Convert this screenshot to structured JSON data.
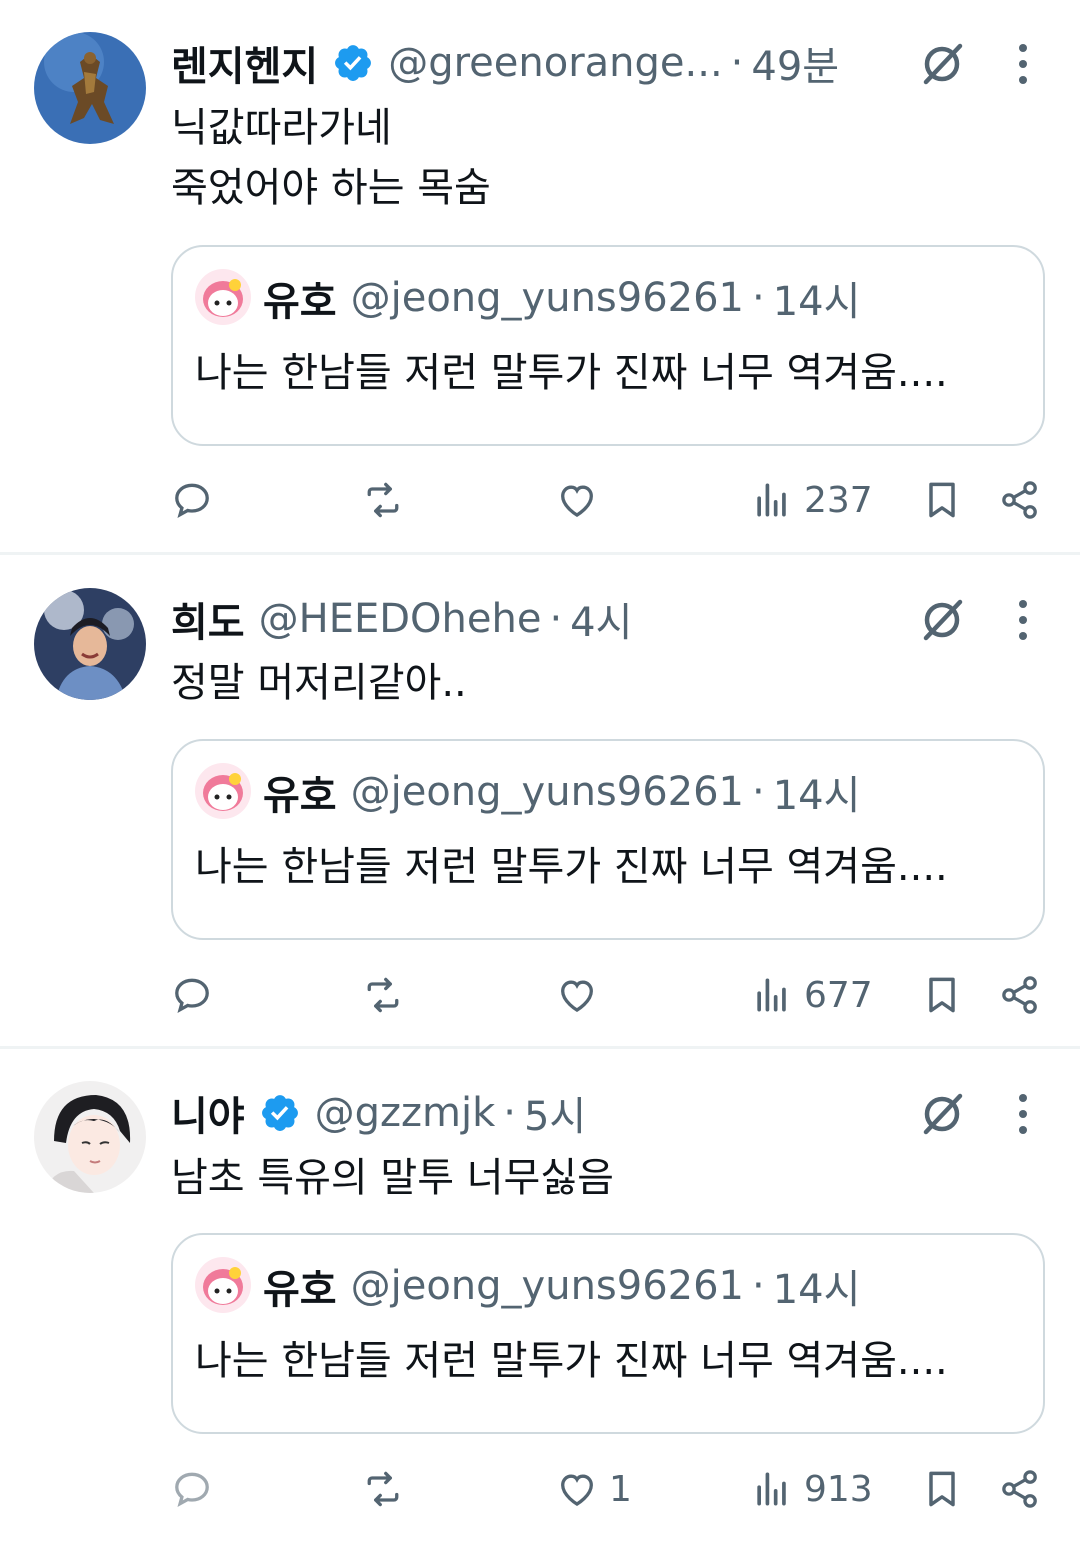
{
  "tweets": [
    {
      "name": "렌지헨지",
      "verified": true,
      "handle": "@greenorange...",
      "time": "49분",
      "lines": [
        "닉값따라가네",
        "죽었어야 하는 목숨"
      ],
      "quote": {
        "name": "유호",
        "handle": "@jeong_yuns96261",
        "time": "14시",
        "text": "나는 한남들 저런 말투가 진짜 너무 역겨움...."
      },
      "likes": "",
      "views": "237"
    },
    {
      "name": "희도",
      "verified": false,
      "handle": "@HEEDOhehe",
      "time": "4시",
      "lines": [
        "정말 머저리같아.."
      ],
      "quote": {
        "name": "유호",
        "handle": "@jeong_yuns96261",
        "time": "14시",
        "text": "나는 한남들 저런 말투가 진짜 너무 역겨움...."
      },
      "likes": "",
      "views": "677"
    },
    {
      "name": "니야",
      "verified": true,
      "handle": "@gzzmjk",
      "time": "5시",
      "lines": [
        "남초 특유의 말투 너무싫음"
      ],
      "quote": {
        "name": "유호",
        "handle": "@jeong_yuns96261",
        "time": "14시",
        "text": "나는 한남들 저런 말투가 진짜 너무 역겨움...."
      },
      "likes": "1",
      "views": "913"
    }
  ],
  "colors": {
    "text": "#0f1419",
    "secondary": "#536471",
    "verified": "#1d9bf0",
    "border": "#cfd9de",
    "divider": "#eff3f4"
  },
  "icons": [
    "grok-icon",
    "more-icon",
    "reply-icon",
    "retweet-icon",
    "like-icon",
    "views-icon",
    "bookmark-icon",
    "share-icon",
    "verified-badge-icon"
  ]
}
